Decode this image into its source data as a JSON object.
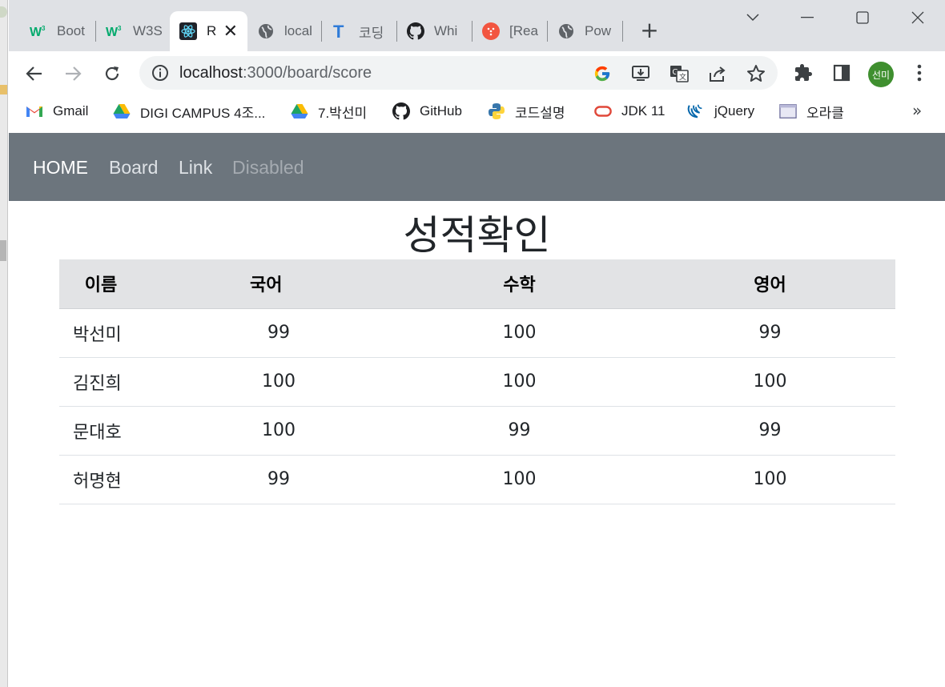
{
  "browser": {
    "tabs": [
      {
        "label": "Boot",
        "icon": "w3schools-icon",
        "active": false
      },
      {
        "label": "W3S",
        "icon": "w3schools-icon",
        "active": false
      },
      {
        "label": "R",
        "icon": "react-icon",
        "active": true
      },
      {
        "label": "local",
        "icon": "globe-icon",
        "active": false
      },
      {
        "label": "코딩",
        "icon": "typora-t-icon",
        "active": false
      },
      {
        "label": "Whi",
        "icon": "github-icon",
        "active": false
      },
      {
        "label": "[Rea",
        "icon": "red-dot-icon",
        "active": false
      },
      {
        "label": "Pow",
        "icon": "globe-icon",
        "active": false
      }
    ],
    "url_host": "localhost",
    "url_path": ":3000/board/score",
    "profile_initials": "선미",
    "bookmarks": [
      {
        "label": "Gmail",
        "icon": "gmail-icon"
      },
      {
        "label": "DIGI CAMPUS 4조...",
        "icon": "drive-icon"
      },
      {
        "label": "7.박선미",
        "icon": "drive-icon"
      },
      {
        "label": "GitHub",
        "icon": "github-icon"
      },
      {
        "label": "코드설명",
        "icon": "python-icon"
      },
      {
        "label": "JDK 11",
        "icon": "oracle-icon"
      },
      {
        "label": "jQuery",
        "icon": "jquery-icon"
      },
      {
        "label": "오라클",
        "icon": "window-icon"
      }
    ],
    "bookmarks_more": "»"
  },
  "nav": {
    "home": "HOME",
    "board": "Board",
    "link": "Link",
    "disabled": "Disabled"
  },
  "page": {
    "title": "성적확인"
  },
  "table": {
    "headers": [
      "이름",
      "국어",
      "수학",
      "영어"
    ],
    "rows": [
      [
        "박선미",
        "99",
        "100",
        "99"
      ],
      [
        "김진희",
        "100",
        "100",
        "100"
      ],
      [
        "문대호",
        "100",
        "99",
        "99"
      ],
      [
        "허명현",
        "99",
        "100",
        "100"
      ]
    ]
  },
  "colors": {
    "navbar_bg": "#6c757d",
    "nav_active": "#ffffff",
    "nav_link": "#dee2e6",
    "nav_disabled": "#a5abb1",
    "table_head_bg": "#e2e3e5",
    "tabstrip_bg": "#dfe1e5"
  }
}
